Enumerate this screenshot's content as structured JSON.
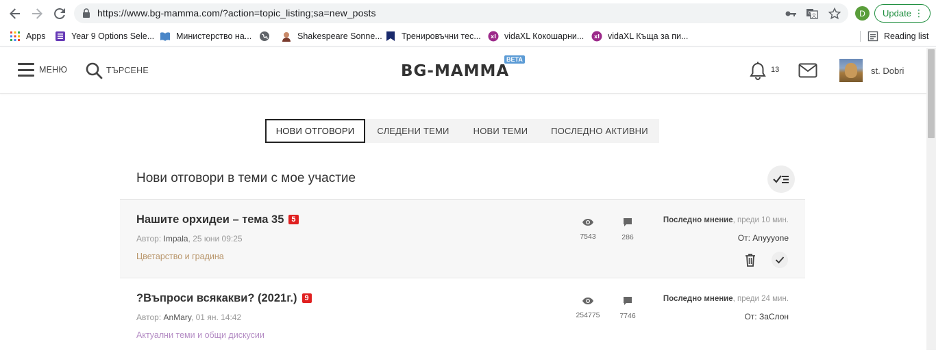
{
  "browser": {
    "url": "https://www.bg-mamma.com/?action=topic_listing;sa=new_posts",
    "profile_initial": "D",
    "update_label": "Update",
    "reading_list": "Reading list",
    "bookmarks": [
      {
        "label": "Apps",
        "icon": "apps-grid-icon"
      },
      {
        "label": "Year 9 Options Sele...",
        "icon": "form-icon"
      },
      {
        "label": "Министерство на...",
        "icon": "book-icon"
      },
      {
        "label": "",
        "icon": "globe-icon"
      },
      {
        "label": "Shakespeare Sonne...",
        "icon": "shakespeare-icon"
      },
      {
        "label": "Тренировъчни тес...",
        "icon": "bookmark-flag-icon"
      },
      {
        "label": "vidaXL Кокошарни...",
        "icon": "vidaxl-icon"
      },
      {
        "label": "vidaXL Къща за пи...",
        "icon": "vidaxl-icon"
      }
    ]
  },
  "header": {
    "menu_label": "МЕНЮ",
    "search_label": "ТЪРСЕНЕ",
    "logo": "BG-MAMMA",
    "beta": "BETA",
    "notification_count": "13",
    "username": "st. Dobri"
  },
  "tabs": [
    {
      "label": "НОВИ ОТГОВОРИ",
      "active": true
    },
    {
      "label": "СЛЕДЕНИ ТЕМИ",
      "active": false
    },
    {
      "label": "НОВИ ТЕМИ",
      "active": false
    },
    {
      "label": "ПОСЛЕДНО АКТИВНИ",
      "active": false
    }
  ],
  "section": {
    "title": "Нови отговори в теми с мое участие"
  },
  "topics": [
    {
      "title": "Нашите орхидеи – тема 35",
      "new_count": "5",
      "author_prefix": "Автор:",
      "author": "Impala",
      "date": ", 25 юни 09:25",
      "category": "Цветарство и градина",
      "category_color": "#b8956a",
      "views": "7543",
      "comments": "286",
      "last_label": "Последно мнение",
      "last_time": ", преди 10 мин.",
      "last_by_prefix": "От:",
      "last_user": "Anyyyone"
    },
    {
      "title": "?Въпроси всякакви? (2021г.)",
      "new_count": "9",
      "author_prefix": "Автор:",
      "author": "AnMary",
      "date": ", 01 ян. 14:42",
      "category": "Актуални теми и общи дискусии",
      "category_color": "#b48cc4",
      "views": "254775",
      "comments": "7746",
      "last_label": "Последно мнение",
      "last_time": ", преди 24 мин.",
      "last_by_prefix": "От:",
      "last_user": "ЗаСлон"
    }
  ]
}
